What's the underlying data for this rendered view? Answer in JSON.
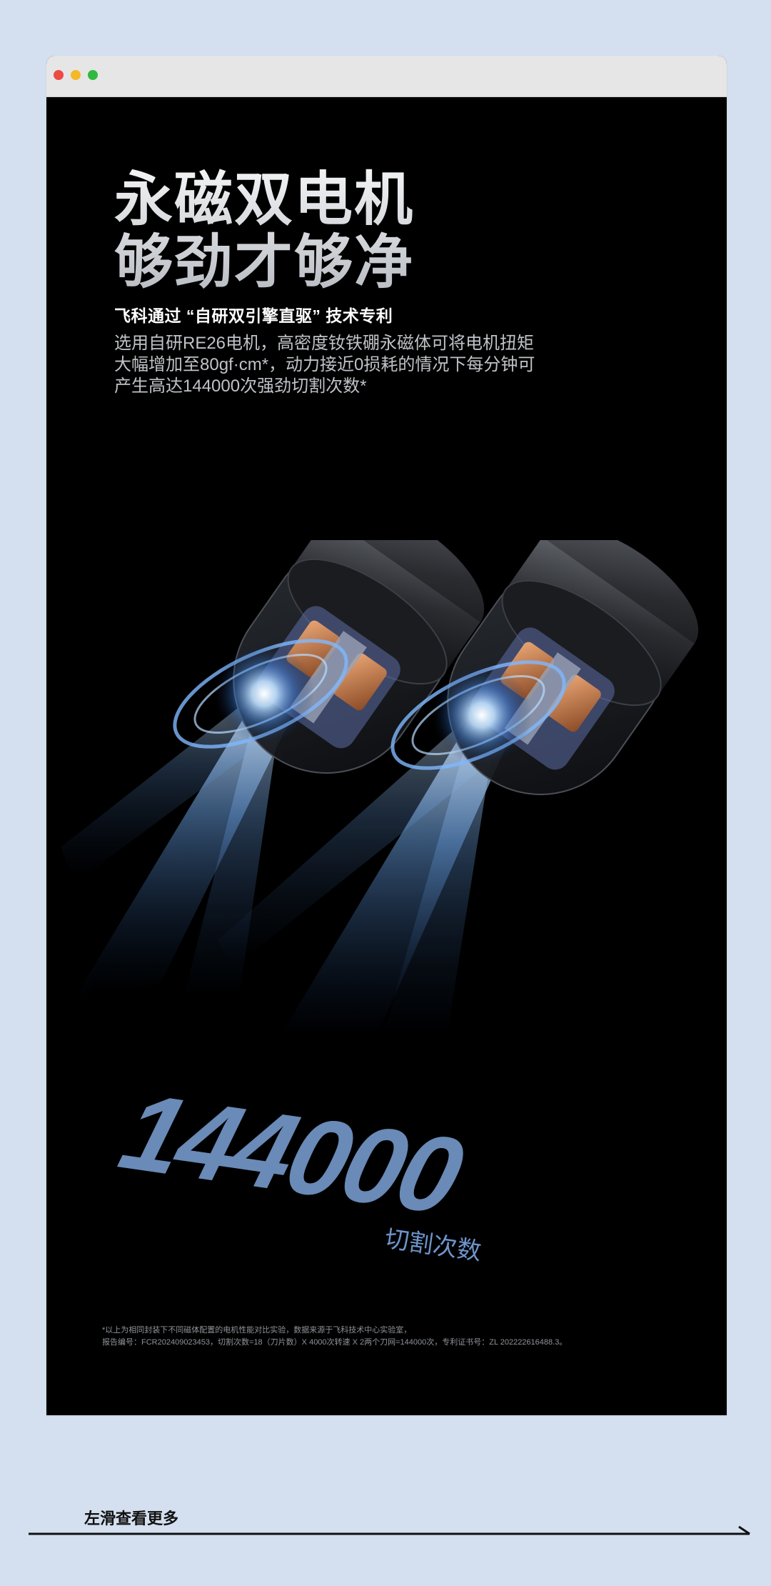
{
  "window": {
    "controls": [
      "close",
      "minimize",
      "maximize"
    ],
    "colors": {
      "close": "#ec4a45",
      "minimize": "#f4b928",
      "maximize": "#2fba3f"
    }
  },
  "hero": {
    "headline_line1": "永磁双电机",
    "headline_line2": "够劲才够净",
    "subheading": "飞科通过 “自研双引擎直驱” 技术专利",
    "description_line1": "选用自研RE26电机，高密度钕铁硼永磁体可将电机扭矩",
    "description_line2": "大幅增加至80gf·cm*，动力接近0损耗的情况下每分钟可",
    "description_line3": "产生高达144000次强劲切割次数*"
  },
  "graphic": {
    "icon": "twin-motor-illustration",
    "big_number": "144000",
    "caption": "切割次数"
  },
  "footnote": {
    "line1": "*以上为相同封装下不同磁体配置的电机性能对比实验，数据来源于飞科技术中心实验室，",
    "line2": "报告编号：FCR202409023453，切割次数=18（刀片数）X 4000次转速 X 2两个刀网=144000次，专利证书号：ZL 202222616488.3。"
  },
  "navigation": {
    "swipe_hint": "左滑查看更多",
    "arrow_icon": "arrow-right-icon"
  },
  "colors": {
    "page_background": "#d4dfef",
    "content_background": "#000000",
    "accent_blue": "#7da3d8"
  }
}
